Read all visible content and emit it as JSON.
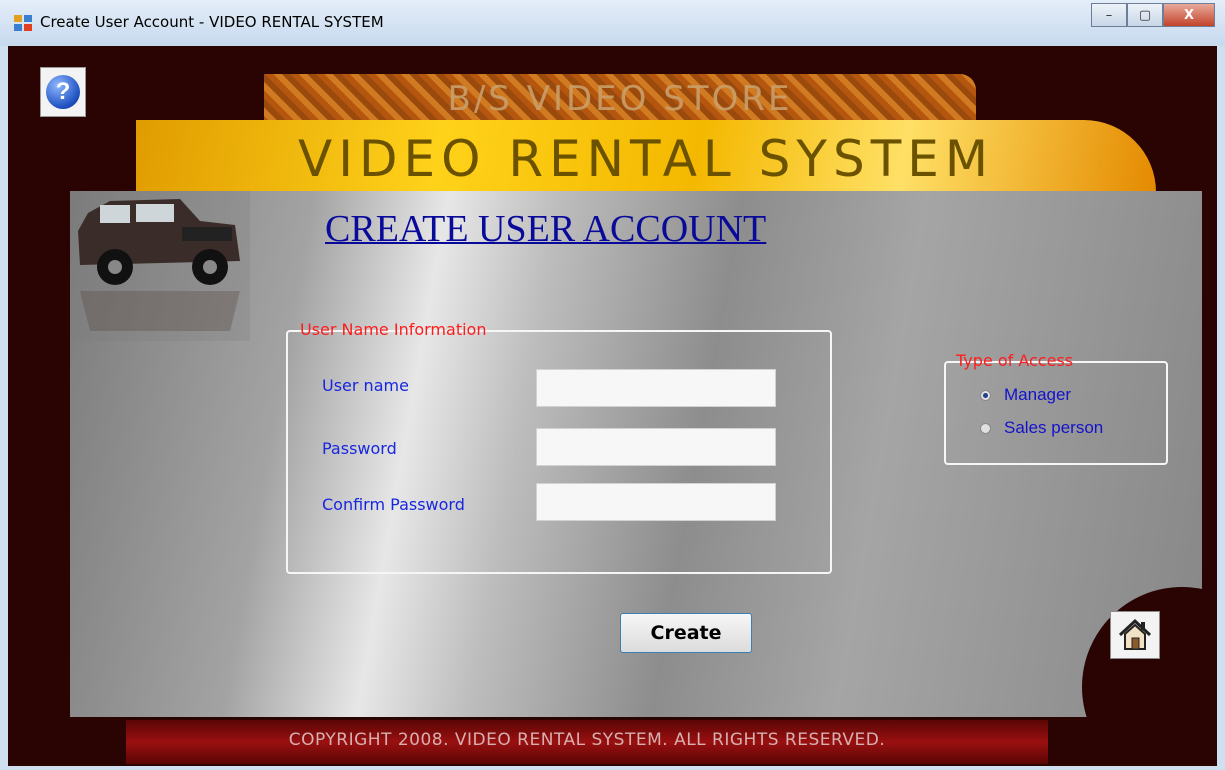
{
  "window": {
    "title": "Create User Account  - VIDEO RENTAL SYSTEM",
    "minimize_glyph": "–",
    "maximize_glyph": "▢",
    "close_glyph": "X"
  },
  "header": {
    "store_name": "B/S VIDEO STORE",
    "system_name": "VIDEO RENTAL SYSTEM",
    "help_glyph": "?"
  },
  "form": {
    "title": "CREATE USER ACCOUNT",
    "user_group": {
      "legend": "User Name Information",
      "fields": [
        {
          "label": "User name",
          "value": ""
        },
        {
          "label": "Password",
          "value": ""
        },
        {
          "label": "Confirm Password",
          "value": ""
        }
      ]
    },
    "access_group": {
      "legend": "Type of Access",
      "options": [
        {
          "label": "Manager",
          "selected": true
        },
        {
          "label": "Sales person",
          "selected": false
        }
      ]
    },
    "create_label": "Create"
  },
  "footer": {
    "copyright": "COPYRIGHT 2008. VIDEO RENTAL SYSTEM. ALL RIGHTS  RESERVED."
  },
  "icons": [
    "app-icon",
    "help-icon",
    "car-image",
    "radio-icon",
    "home-icon"
  ],
  "colors": {
    "background": "#2a0303",
    "legend": "#ff1c1c",
    "label": "#1726e0",
    "title": "#0a0a9a"
  }
}
